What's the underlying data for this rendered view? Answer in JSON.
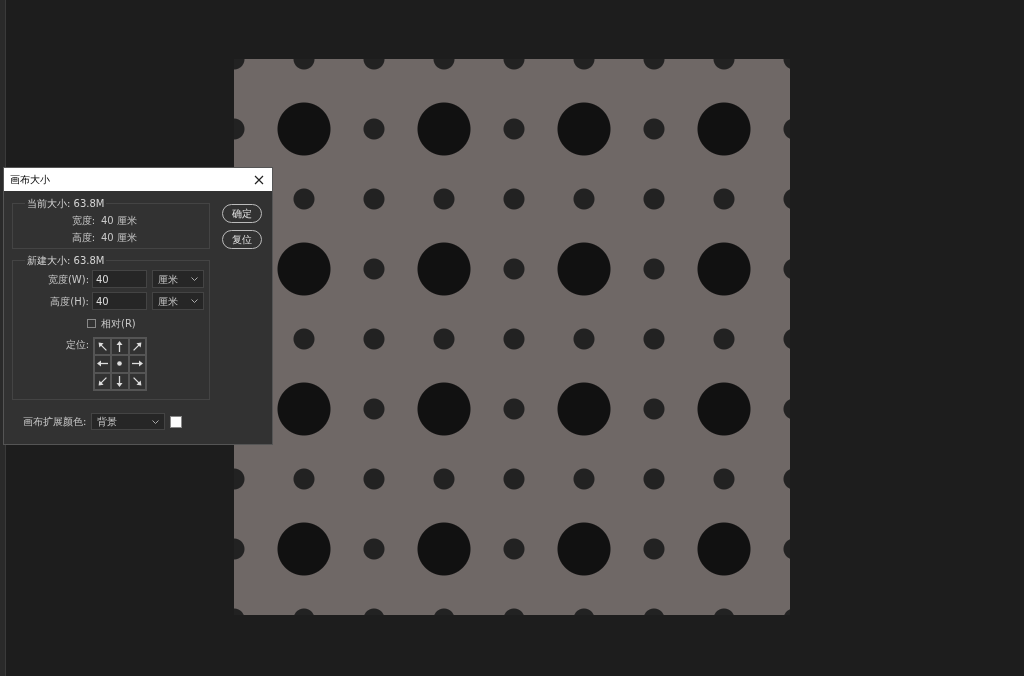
{
  "dialog": {
    "title": "画布大小",
    "current": {
      "title": "当前大小: 63.8M",
      "rows": [
        {
          "label": "宽度:",
          "value": "40 厘米"
        },
        {
          "label": "高度:",
          "value": "40 厘米"
        }
      ]
    },
    "new": {
      "title": "新建大小: 63.8M",
      "fields": [
        {
          "label": "宽度(W):",
          "value": "40",
          "unit": "厘米"
        },
        {
          "label": "高度(H):",
          "value": "40",
          "unit": "厘米"
        }
      ],
      "relative": {
        "label": "相对(R)",
        "checked": false
      },
      "anchor": {
        "label": "定位:",
        "cells": [
          {
            "selected": false
          },
          {
            "selected": false
          },
          {
            "selected": false
          },
          {
            "selected": false
          },
          {
            "selected": true
          },
          {
            "selected": false
          },
          {
            "selected": false
          },
          {
            "selected": false
          },
          {
            "selected": false
          }
        ]
      }
    },
    "extension_color": {
      "label": "画布扩展颜色:",
      "value": "背景",
      "color": "#ffffff"
    },
    "buttons": [
      "确定",
      "复位"
    ]
  }
}
